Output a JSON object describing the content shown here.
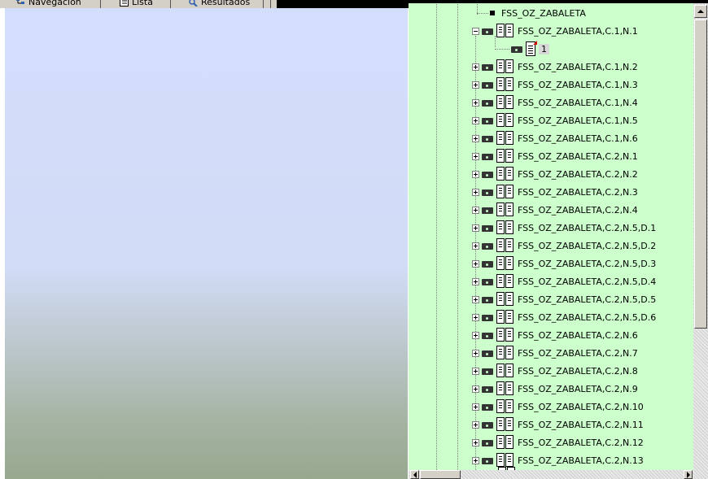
{
  "tabs": [
    {
      "label": "Navegación",
      "icon": "tree-icon"
    },
    {
      "label": "Lista",
      "icon": "list-icon"
    },
    {
      "label": "Resultados",
      "icon": "results-icon"
    }
  ],
  "tree": {
    "root": {
      "label": "FSS_OZ_ZABALETA"
    },
    "expanded": {
      "label": "FSS_OZ_ZABALETA,C.1,N.1",
      "child": "1"
    },
    "items": [
      "FSS_OZ_ZABALETA,C.1,N.2",
      "FSS_OZ_ZABALETA,C.1,N.3",
      "FSS_OZ_ZABALETA,C.1,N.4",
      "FSS_OZ_ZABALETA,C.1,N.5",
      "FSS_OZ_ZABALETA,C.1,N.6",
      "FSS_OZ_ZABALETA,C.2,N.1",
      "FSS_OZ_ZABALETA,C.2,N.2",
      "FSS_OZ_ZABALETA,C.2,N.3",
      "FSS_OZ_ZABALETA,C.2,N.4",
      "FSS_OZ_ZABALETA,C.2,N.5,D.1",
      "FSS_OZ_ZABALETA,C.2,N.5,D.2",
      "FSS_OZ_ZABALETA,C.2,N.5,D.3",
      "FSS_OZ_ZABALETA,C.2,N.5,D.4",
      "FSS_OZ_ZABALETA,C.2,N.5,D.5",
      "FSS_OZ_ZABALETA,C.2,N.5,D.6",
      "FSS_OZ_ZABALETA,C.2,N.6",
      "FSS_OZ_ZABALETA,C.2,N.7",
      "FSS_OZ_ZABALETA,C.2,N.8",
      "FSS_OZ_ZABALETA,C.2,N.9",
      "FSS_OZ_ZABALETA,C.2,N.10",
      "FSS_OZ_ZABALETA,C.2,N.11",
      "FSS_OZ_ZABALETA,C.2,N.12",
      "FSS_OZ_ZABALETA,C.2,N.13"
    ]
  },
  "colors": {
    "tree_background": "#ccffcc",
    "panel_top": "#d3defd",
    "panel_bottom": "#97a88f"
  }
}
